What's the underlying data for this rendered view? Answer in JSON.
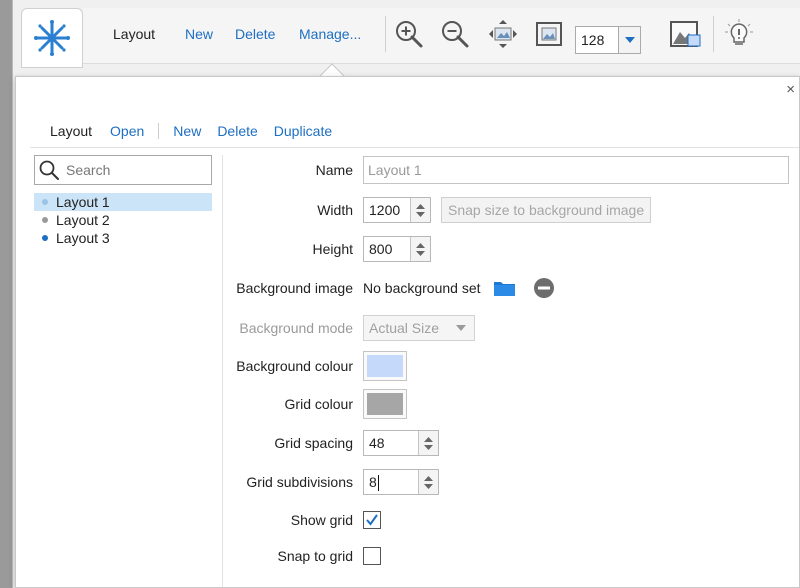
{
  "toolbar": {
    "layout_label": "Layout",
    "new_label": "New",
    "delete_label": "Delete",
    "manage_label": "Manage...",
    "zoom_value": "128"
  },
  "popup": {
    "close_glyph": "×",
    "subtoolbar": {
      "active_label": "Layout",
      "open_label": "Open",
      "new_label": "New",
      "delete_label": "Delete",
      "duplicate_label": "Duplicate"
    }
  },
  "sidebar": {
    "search_placeholder": "Search",
    "items": [
      {
        "label": "Layout 1",
        "bullet_color": "#9bc3e6"
      },
      {
        "label": "Layout 2",
        "bullet_color": "#9a9a9a"
      },
      {
        "label": "Layout 3",
        "bullet_color": "#1e6fc2"
      }
    ]
  },
  "form": {
    "name_label": "Name",
    "name_value": "Layout 1",
    "width_label": "Width",
    "width_value": "1200",
    "snap_button_label": "Snap size to background image",
    "height_label": "Height",
    "height_value": "800",
    "bg_image_label": "Background image",
    "bg_image_value": "No background set",
    "bg_mode_label": "Background mode",
    "bg_mode_value": "Actual Size",
    "bg_colour_label": "Background colour",
    "bg_colour": "#c5d9fb",
    "grid_colour_label": "Grid colour",
    "grid_colour": "#a6a6a6",
    "grid_spacing_label": "Grid spacing",
    "grid_spacing_value": "48",
    "grid_subdivisions_label": "Grid subdivisions",
    "grid_subdivisions_value": "8",
    "show_grid_label": "Show grid",
    "show_grid_checked": true,
    "snap_to_grid_label": "Snap to grid",
    "snap_to_grid_checked": false
  },
  "colors": {
    "accent": "#1e6fc2",
    "selection": "#cce4f7"
  },
  "icons": [
    "app-logo-icon",
    "zoom-in-icon",
    "zoom-out-icon",
    "fit-to-window-icon",
    "actual-size-icon",
    "zoom-dropdown-icon",
    "background-image-icon",
    "lightbulb-icon",
    "folder-icon",
    "remove-icon",
    "search-icon",
    "close-icon"
  ]
}
